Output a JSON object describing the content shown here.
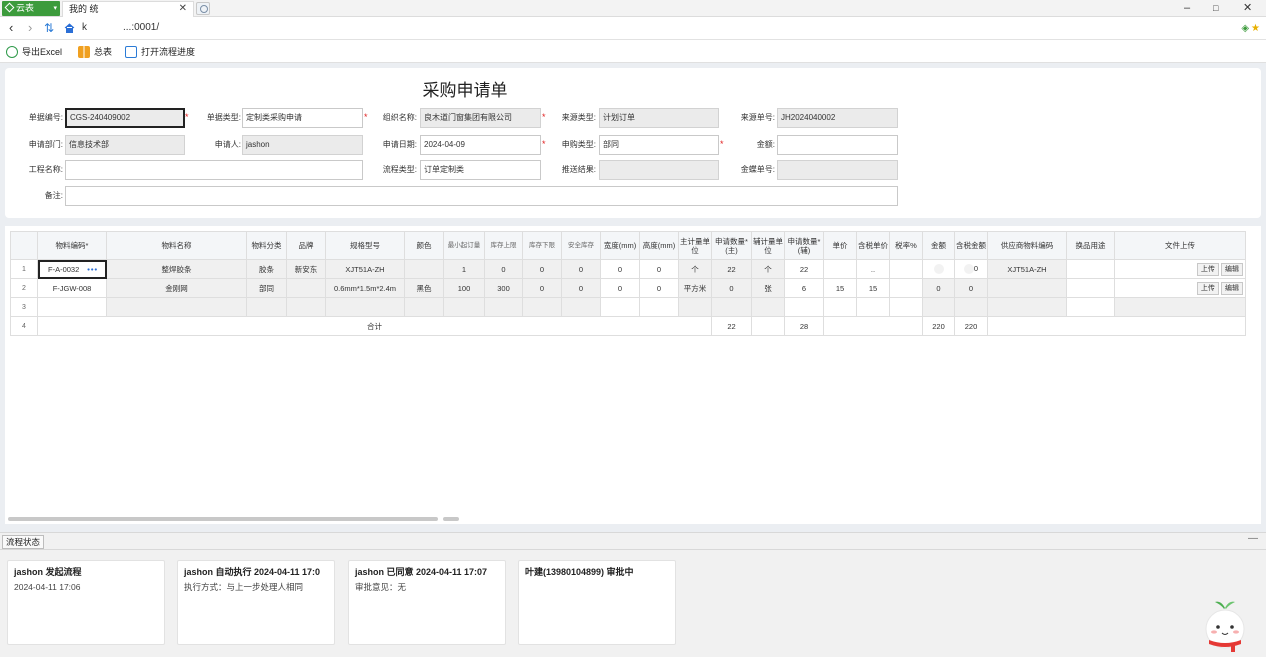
{
  "browser": {
    "app_label": "云表",
    "tab_title": "我的    统",
    "url_visible": "k",
    "url_tail": "...:0001/",
    "window_controls": [
      "–",
      "□",
      "✕"
    ]
  },
  "toolbar": {
    "export_excel": "导出Excel",
    "summary": "总表",
    "open_flow": "打开流程进度"
  },
  "form": {
    "title": "采购申请单",
    "labels": {
      "doc_no": "单据编号:",
      "doc_type": "单据类型:",
      "org_name": "组织名称:",
      "source_type": "来源类型:",
      "source_no": "来源单号:",
      "dept": "申请部门:",
      "applicant": "申请人:",
      "apply_date": "申请日期:",
      "purchase_type": "申购类型:",
      "amount": "金额:",
      "project": "工程名称:",
      "flow_type": "流程类型:",
      "push_result": "推送结果:",
      "amount_no": "金蝶单号:",
      "remark": "备注:"
    },
    "values": {
      "doc_no": "CGS-240409002",
      "doc_type": "定制类采购申请",
      "org_name": "良木道门窗集团有限公司",
      "source_type": "计划订单",
      "source_no": "JH2024040002",
      "dept": "信息技术部",
      "applicant": "jashon",
      "apply_date": "2024-04-09",
      "purchase_type": "部同",
      "amount": "",
      "project": "",
      "flow_type": "订单定制类",
      "push_result": "",
      "amount_no": "",
      "remark": ""
    }
  },
  "grid": {
    "headers": [
      "物料编码*",
      "物料名称",
      "物料分类",
      "品牌",
      "规格型号",
      "颜色",
      "最小起订量",
      "库存上限",
      "库存下限",
      "安全库存",
      "宽度(mm)",
      "高度(mm)",
      "主计量单位",
      "申请数量*(主)",
      "辅计量单位",
      "申请数量*(辅)",
      "单价",
      "含税单价",
      "税率%",
      "金额",
      "含税金额",
      "供应商物料编码",
      "换品用途",
      "文件上传"
    ],
    "rows": [
      {
        "num": "1",
        "code": "F-A-0032",
        "name": "整焊胶条",
        "category": "胶条",
        "brand": "新安东",
        "spec": "XJT51A-ZH",
        "color": "",
        "min_order": "1",
        "stock_max": "0",
        "stock_min": "0",
        "safe_stock": "0",
        "width": "0",
        "height": "0",
        "unit_main": "个",
        "qty_main": "22",
        "unit_aux": "个",
        "qty_aux": "22",
        "price": "",
        "tax_price": "..",
        "tax_rate": "",
        "amount": "",
        "tax_amount": "0",
        "supplier_code": "XJT51A-ZH",
        "usage": "",
        "upload": "上传",
        "edit": "编辑"
      },
      {
        "num": "2",
        "code": "F-JGW-008",
        "name": "金刚网",
        "category": "部同",
        "brand": "",
        "spec": "0.6mm*1.5m*2.4m",
        "color": "黑色",
        "min_order": "100",
        "stock_max": "300",
        "stock_min": "0",
        "safe_stock": "0",
        "width": "0",
        "height": "0",
        "unit_main": "平方米",
        "qty_main": "0",
        "unit_aux": "张",
        "qty_aux": "6",
        "price": "15",
        "tax_price": "15",
        "tax_rate": "",
        "amount": "0",
        "tax_amount": "0",
        "supplier_code": "",
        "usage": "",
        "upload": "上传",
        "edit": "编辑"
      },
      {
        "num": "3"
      },
      {
        "num": "4",
        "total_label": "合计",
        "qty_main": "22",
        "qty_aux": "28",
        "amount": "220",
        "tax_amount": "220"
      }
    ]
  },
  "status": {
    "tab": "流程状态",
    "minimize": "—",
    "cards": [
      {
        "title": "jashon  发起流程",
        "sub": "2024-04-11 17:06"
      },
      {
        "title": "jashon  自动执行  2024-04-11 17:0",
        "sub": "执行方式：与上一步处理人相同"
      },
      {
        "title": "jashon  已同意  2024-04-11 17:07",
        "sub": "审批意见：无"
      },
      {
        "title": "叶建(13980104899)  审批中",
        "sub": ""
      }
    ]
  },
  "colors": {
    "app_green": "#3c9b3c",
    "required_red": "#e02020",
    "readonly_gray": "#ebebeb",
    "background": "#ebeef2"
  }
}
